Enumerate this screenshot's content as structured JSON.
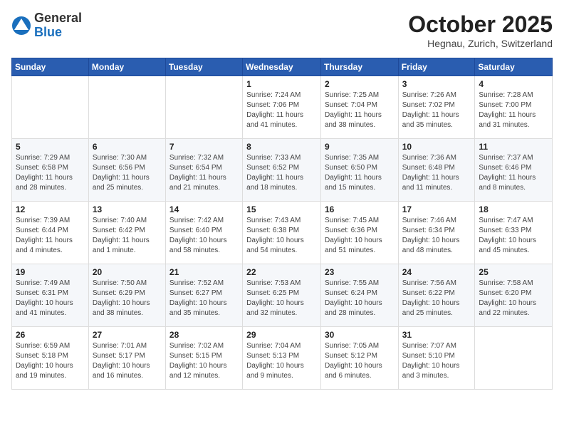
{
  "header": {
    "logo_line1": "General",
    "logo_line2": "Blue",
    "month": "October 2025",
    "location": "Hegnau, Zurich, Switzerland"
  },
  "weekdays": [
    "Sunday",
    "Monday",
    "Tuesday",
    "Wednesday",
    "Thursday",
    "Friday",
    "Saturday"
  ],
  "weeks": [
    [
      {
        "day": "",
        "info": ""
      },
      {
        "day": "",
        "info": ""
      },
      {
        "day": "",
        "info": ""
      },
      {
        "day": "1",
        "info": "Sunrise: 7:24 AM\nSunset: 7:06 PM\nDaylight: 11 hours\nand 41 minutes."
      },
      {
        "day": "2",
        "info": "Sunrise: 7:25 AM\nSunset: 7:04 PM\nDaylight: 11 hours\nand 38 minutes."
      },
      {
        "day": "3",
        "info": "Sunrise: 7:26 AM\nSunset: 7:02 PM\nDaylight: 11 hours\nand 35 minutes."
      },
      {
        "day": "4",
        "info": "Sunrise: 7:28 AM\nSunset: 7:00 PM\nDaylight: 11 hours\nand 31 minutes."
      }
    ],
    [
      {
        "day": "5",
        "info": "Sunrise: 7:29 AM\nSunset: 6:58 PM\nDaylight: 11 hours\nand 28 minutes."
      },
      {
        "day": "6",
        "info": "Sunrise: 7:30 AM\nSunset: 6:56 PM\nDaylight: 11 hours\nand 25 minutes."
      },
      {
        "day": "7",
        "info": "Sunrise: 7:32 AM\nSunset: 6:54 PM\nDaylight: 11 hours\nand 21 minutes."
      },
      {
        "day": "8",
        "info": "Sunrise: 7:33 AM\nSunset: 6:52 PM\nDaylight: 11 hours\nand 18 minutes."
      },
      {
        "day": "9",
        "info": "Sunrise: 7:35 AM\nSunset: 6:50 PM\nDaylight: 11 hours\nand 15 minutes."
      },
      {
        "day": "10",
        "info": "Sunrise: 7:36 AM\nSunset: 6:48 PM\nDaylight: 11 hours\nand 11 minutes."
      },
      {
        "day": "11",
        "info": "Sunrise: 7:37 AM\nSunset: 6:46 PM\nDaylight: 11 hours\nand 8 minutes."
      }
    ],
    [
      {
        "day": "12",
        "info": "Sunrise: 7:39 AM\nSunset: 6:44 PM\nDaylight: 11 hours\nand 4 minutes."
      },
      {
        "day": "13",
        "info": "Sunrise: 7:40 AM\nSunset: 6:42 PM\nDaylight: 11 hours\nand 1 minute."
      },
      {
        "day": "14",
        "info": "Sunrise: 7:42 AM\nSunset: 6:40 PM\nDaylight: 10 hours\nand 58 minutes."
      },
      {
        "day": "15",
        "info": "Sunrise: 7:43 AM\nSunset: 6:38 PM\nDaylight: 10 hours\nand 54 minutes."
      },
      {
        "day": "16",
        "info": "Sunrise: 7:45 AM\nSunset: 6:36 PM\nDaylight: 10 hours\nand 51 minutes."
      },
      {
        "day": "17",
        "info": "Sunrise: 7:46 AM\nSunset: 6:34 PM\nDaylight: 10 hours\nand 48 minutes."
      },
      {
        "day": "18",
        "info": "Sunrise: 7:47 AM\nSunset: 6:33 PM\nDaylight: 10 hours\nand 45 minutes."
      }
    ],
    [
      {
        "day": "19",
        "info": "Sunrise: 7:49 AM\nSunset: 6:31 PM\nDaylight: 10 hours\nand 41 minutes."
      },
      {
        "day": "20",
        "info": "Sunrise: 7:50 AM\nSunset: 6:29 PM\nDaylight: 10 hours\nand 38 minutes."
      },
      {
        "day": "21",
        "info": "Sunrise: 7:52 AM\nSunset: 6:27 PM\nDaylight: 10 hours\nand 35 minutes."
      },
      {
        "day": "22",
        "info": "Sunrise: 7:53 AM\nSunset: 6:25 PM\nDaylight: 10 hours\nand 32 minutes."
      },
      {
        "day": "23",
        "info": "Sunrise: 7:55 AM\nSunset: 6:24 PM\nDaylight: 10 hours\nand 28 minutes."
      },
      {
        "day": "24",
        "info": "Sunrise: 7:56 AM\nSunset: 6:22 PM\nDaylight: 10 hours\nand 25 minutes."
      },
      {
        "day": "25",
        "info": "Sunrise: 7:58 AM\nSunset: 6:20 PM\nDaylight: 10 hours\nand 22 minutes."
      }
    ],
    [
      {
        "day": "26",
        "info": "Sunrise: 6:59 AM\nSunset: 5:18 PM\nDaylight: 10 hours\nand 19 minutes."
      },
      {
        "day": "27",
        "info": "Sunrise: 7:01 AM\nSunset: 5:17 PM\nDaylight: 10 hours\nand 16 minutes."
      },
      {
        "day": "28",
        "info": "Sunrise: 7:02 AM\nSunset: 5:15 PM\nDaylight: 10 hours\nand 12 minutes."
      },
      {
        "day": "29",
        "info": "Sunrise: 7:04 AM\nSunset: 5:13 PM\nDaylight: 10 hours\nand 9 minutes."
      },
      {
        "day": "30",
        "info": "Sunrise: 7:05 AM\nSunset: 5:12 PM\nDaylight: 10 hours\nand 6 minutes."
      },
      {
        "day": "31",
        "info": "Sunrise: 7:07 AM\nSunset: 5:10 PM\nDaylight: 10 hours\nand 3 minutes."
      },
      {
        "day": "",
        "info": ""
      }
    ]
  ]
}
